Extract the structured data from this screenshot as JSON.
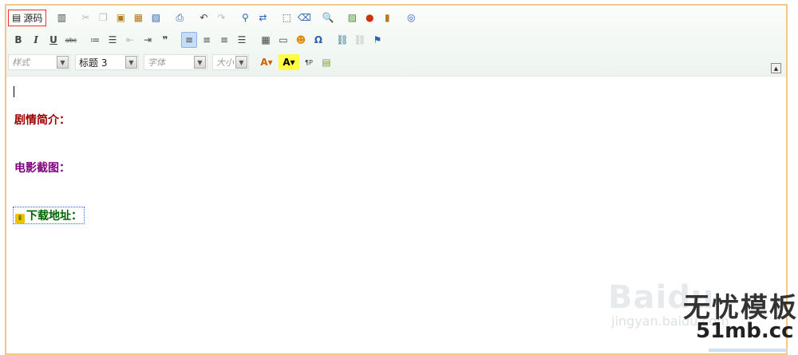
{
  "colors": {
    "border": "#f4c986",
    "toolbar_bg": "#edf4ef",
    "heading1": "#a00000",
    "heading2": "#800080",
    "heading3": "#006400",
    "source_btn_border": "#ee3333"
  },
  "toolbar": {
    "source_label": "源码",
    "style_placeholder": "样式",
    "format_value": "标题 3",
    "font_placeholder": "字体",
    "size_placeholder": "大小",
    "row1_icons": [
      "templates-icon",
      "cut-icon",
      "copy-icon",
      "paste-icon",
      "paste-text-icon",
      "paste-word-icon",
      "print-icon",
      "undo-icon",
      "redo-icon",
      "find-icon",
      "replace-icon",
      "select-all-icon",
      "remove-format-icon",
      "preview-icon",
      "image-icon",
      "flash-icon",
      "table-icon",
      "fullscreen-icon"
    ],
    "row2_icons": [
      "bold-icon",
      "italic-icon",
      "underline-icon",
      "strikethrough-icon",
      "numbered-list-icon",
      "bulleted-list-icon",
      "outdent-icon",
      "indent-icon",
      "blockquote-icon",
      "align-left-icon",
      "align-center-icon",
      "align-right-icon",
      "justify-icon",
      "table-icon",
      "horizontal-rule-icon",
      "smiley-icon",
      "special-char-icon",
      "link-icon",
      "unlink-icon",
      "anchor-icon"
    ],
    "row3_icons": [
      "text-color-icon",
      "background-color-icon",
      "page-break-icon",
      "show-blocks-icon"
    ]
  },
  "content": {
    "line1": "剧情简介：",
    "line2": "电影截图：",
    "line3": "下载地址："
  },
  "watermark": {
    "baidu": "Baidu",
    "jingyan": "jingyan.baidu.com",
    "cn": "无忧模板",
    "url": "51mb.cc"
  }
}
